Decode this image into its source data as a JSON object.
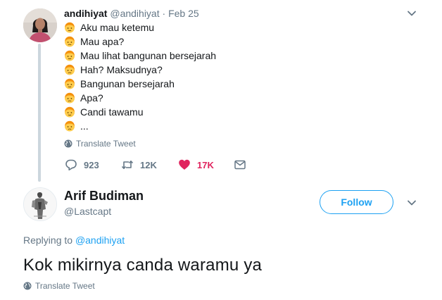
{
  "parent_tweet": {
    "name": "andihiyat",
    "handle": "@andihiyat",
    "separator": "·",
    "date": "Feb 25",
    "lines": [
      {
        "text": "Aku mau ketemu",
        "emoji": "person-blond-emoji"
      },
      {
        "text": "Mau apa?",
        "emoji": "person-frowning-emoji"
      },
      {
        "text": "Mau lihat bangunan bersejarah",
        "emoji": "person-blond-emoji"
      },
      {
        "text": "Hah? Maksudnya?",
        "emoji": "person-frowning-emoji"
      },
      {
        "text": "Bangunan bersejarah",
        "emoji": "person-blond-emoji"
      },
      {
        "text": "Apa?",
        "emoji": "person-frowning-emoji"
      },
      {
        "text": "Candi tawamu",
        "emoji": "person-blond-emoji"
      },
      {
        "text": "...",
        "emoji": "person-frowning-emoji"
      }
    ],
    "translate_label": "Translate Tweet",
    "actions": {
      "reply_count": "923",
      "retweet_count": "12K",
      "like_count": "17K"
    }
  },
  "reply_tweet": {
    "name": "Arif Budiman",
    "handle": "@Lastcapt",
    "follow_label": "Follow",
    "replying_prefix": "Replying to",
    "replying_to": "@andihiyat",
    "text": "Kok mikirnya canda waramu ya",
    "translate_label": "Translate Tweet"
  },
  "colors": {
    "accent": "#1da1f2",
    "like": "#e0245e",
    "muted": "#657786",
    "text": "#14171a",
    "thread_line": "#ccd6dd"
  }
}
